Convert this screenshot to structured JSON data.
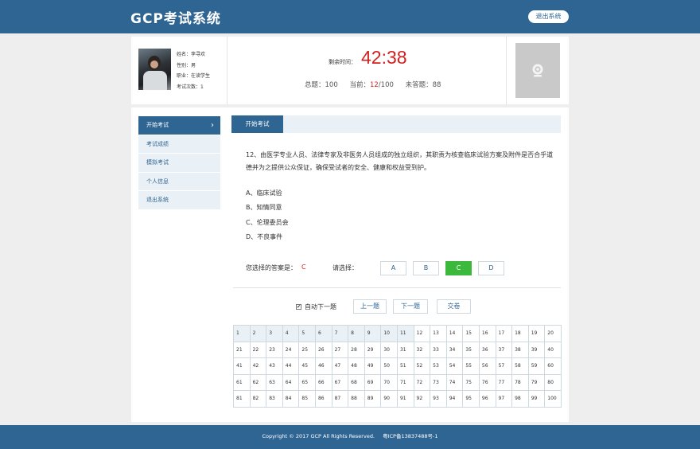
{
  "header": {
    "title": "GCP考试系统",
    "logout_label": "退出系统",
    "brand_color": "#2f6593"
  },
  "user": {
    "name": "姓名：李寻欢",
    "gender": "性别：男",
    "occupation": "职业：在读学生",
    "exam_count": "考试次数：1"
  },
  "timer": {
    "label": "剩余时间：",
    "value": "42:38"
  },
  "stats": {
    "total_label": "总题：",
    "total": "100",
    "current_label": "当前：",
    "current": "12",
    "current_total": "/100",
    "unanswered_label": "未答题：",
    "unanswered": "88"
  },
  "camera": {
    "icon": "webcam-icon"
  },
  "sidebar": {
    "items": [
      {
        "label": "开始考试",
        "active": true
      },
      {
        "label": "考试成绩",
        "active": false
      },
      {
        "label": "模拟考试",
        "active": false
      },
      {
        "label": "个人信息",
        "active": false
      },
      {
        "label": "退出系统",
        "active": false
      }
    ]
  },
  "tab": {
    "label": "开始考试"
  },
  "question": {
    "text": "12、由医学专业人员、法律专家及非医务人员组成的独立组织，其职责为核查临床试验方案及附件是否合乎道德并为之提供公众保证，确保受试者的安全、健康和权益受到护。",
    "options": [
      "A、临床试验",
      "B、知情同意",
      "C、伦理委员会",
      "D、不良事件"
    ]
  },
  "answer": {
    "selected_label": "您选择的答案是：",
    "selected_value": "C",
    "choose_label": "请选择：",
    "choices": [
      "A",
      "B",
      "C",
      "D"
    ],
    "selected_color": "#3cb83c"
  },
  "navigation": {
    "auto_next_label": "自动下一题",
    "auto_next_checked": true,
    "prev_label": "上一题",
    "next_label": "下一题",
    "submit_label": "交卷"
  },
  "question_grid": {
    "numbers": [
      1,
      2,
      3,
      4,
      5,
      6,
      7,
      8,
      9,
      10,
      11,
      12,
      13,
      14,
      15,
      16,
      17,
      18,
      19,
      20,
      21,
      22,
      23,
      24,
      25,
      26,
      27,
      28,
      29,
      30,
      31,
      32,
      33,
      34,
      35,
      36,
      37,
      38,
      39,
      40,
      41,
      42,
      43,
      44,
      45,
      46,
      47,
      48,
      49,
      50,
      51,
      52,
      53,
      54,
      55,
      56,
      57,
      58,
      59,
      60,
      61,
      62,
      63,
      64,
      65,
      66,
      67,
      68,
      69,
      70,
      71,
      72,
      73,
      74,
      75,
      76,
      77,
      78,
      79,
      80,
      81,
      82,
      83,
      84,
      85,
      86,
      87,
      88,
      89,
      90,
      91,
      92,
      93,
      94,
      95,
      96,
      97,
      98,
      99,
      100
    ],
    "answered_count": 11
  },
  "footer": {
    "copyright": "Copyright © 2017 GCP All Rights Reserved.",
    "icp": "粤ICP备13837488号-1"
  }
}
